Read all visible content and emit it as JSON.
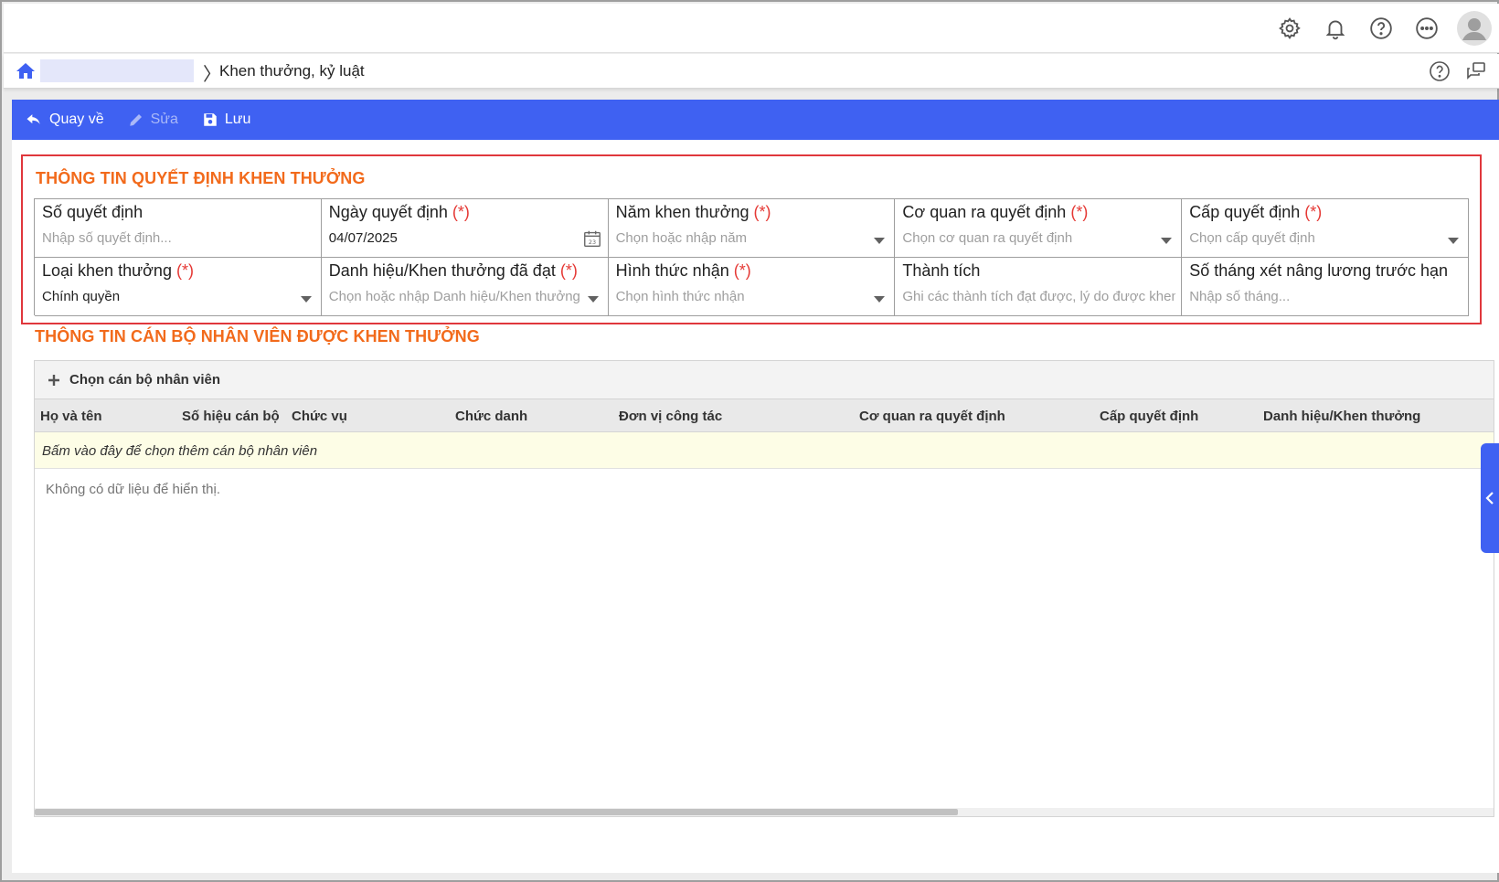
{
  "topbar": {
    "icons": [
      "gear-icon",
      "bell-icon",
      "help-circle-icon",
      "more-dots-icon",
      "avatar-icon"
    ]
  },
  "breadcrumb": {
    "separator": "〉",
    "current": "Khen thưởng, kỷ luật"
  },
  "toolbar": {
    "back_label": "Quay về",
    "edit_label": "Sửa",
    "save_label": "Lưu"
  },
  "decision_section": {
    "title": "THÔNG TIN QUYẾT ĐỊNH KHEN THƯỞNG",
    "required_mark": "(*)",
    "fields": [
      {
        "label": "Số quyết định",
        "value": "",
        "placeholder": "Nhập số quyết định..."
      },
      {
        "label": "Ngày quyết định",
        "value": "04/07/2025",
        "placeholder": ""
      },
      {
        "label": "Năm khen thưởng",
        "value": "",
        "placeholder": "Chọn hoặc nhập năm"
      },
      {
        "label": "Cơ quan ra quyết định",
        "value": "",
        "placeholder": "Chọn cơ quan ra quyết định"
      },
      {
        "label": "Cấp quyết định",
        "value": "",
        "placeholder": "Chọn cấp quyết định"
      },
      {
        "label": "Loại khen thưởng",
        "value": "Chính quyền",
        "placeholder": ""
      },
      {
        "label": "Danh hiệu/Khen thưởng đã đạt",
        "value": "",
        "placeholder": "Chọn hoặc nhập Danh hiệu/Khen thưởng"
      },
      {
        "label": "Hình thức nhận",
        "value": "",
        "placeholder": "Chọn hình thức nhận"
      },
      {
        "label": "Thành tích",
        "value": "",
        "placeholder": "Ghi các thành tích đạt được, lý do được khen thưởng"
      },
      {
        "label": "Số tháng xét nâng lương trước hạn",
        "value": "",
        "placeholder": "Nhập số tháng..."
      }
    ]
  },
  "employee_section": {
    "title": "THÔNG TIN CÁN BỘ NHÂN VIÊN ĐƯỢC KHEN THƯỞNG",
    "add_button": "Chọn cán bộ nhân viên",
    "columns": [
      "Họ và tên",
      "Số hiệu cán bộ",
      "Chức vụ",
      "Chức danh",
      "Đơn vị công tác",
      "Cơ quan ra quyết định",
      "Cấp quyết định",
      "Danh hiệu/Khen thưởng"
    ],
    "add_row_hint": "Bấm vào đây để chọn thêm cán bộ nhân viên",
    "empty_text": "Không có dữ liệu để hiển thị."
  },
  "colors": {
    "toolbar_bg": "#3f61f2",
    "section_title": "#f26a1b",
    "required": "#e53935",
    "highlight_border": "#e0373c"
  }
}
